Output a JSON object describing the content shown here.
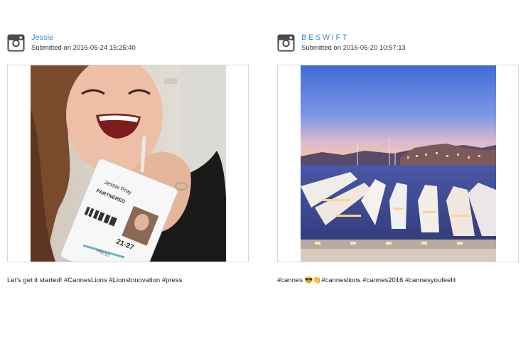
{
  "posts": [
    {
      "username": "Jessie",
      "submitted": "Submitted on 2016-05-24 15:25:40",
      "badge": {
        "name": "Jessie Pray",
        "tag": "PARTNERED",
        "number": "21-27",
        "type": "PRESS"
      },
      "caption": "Let's get it started! #CannesLions #LionsInnovation #press",
      "icon": "instagram-icon"
    },
    {
      "username": "BESWIFT",
      "submitted": "Submitted on 2016-05-20 10:57:13",
      "caption": "#cannes 😎👏#canneslions #cannes2016 #cannesyoufeelit",
      "icon": "instagram-icon"
    }
  ],
  "colors": {
    "username_link": "#3b8fd6",
    "frame_border": "#d8d8d8",
    "icon": "#4a4a4a"
  }
}
